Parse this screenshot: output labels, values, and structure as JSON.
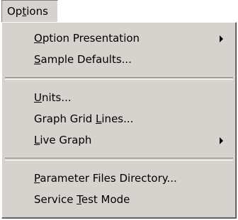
{
  "menubar": {
    "title": "Options",
    "title_parts": [
      "Op",
      "t",
      "ions"
    ]
  },
  "menu": {
    "groups": [
      [
        {
          "label": "Option Presentation",
          "parts": [
            "",
            "O",
            "ption Presentation"
          ],
          "submenu": true
        },
        {
          "label": "Sample Defaults...",
          "parts": [
            "",
            "S",
            "ample Defaults..."
          ],
          "submenu": false
        }
      ],
      [
        {
          "label": "Units...",
          "parts": [
            "",
            "U",
            "nits..."
          ],
          "submenu": false
        },
        {
          "label": "Graph Grid Lines...",
          "parts": [
            "Graph Grid ",
            "L",
            "ines..."
          ],
          "submenu": false
        },
        {
          "label": "Live Graph",
          "parts": [
            "",
            "L",
            "ive Graph"
          ],
          "submenu": true
        }
      ],
      [
        {
          "label": "Parameter Files Directory...",
          "parts": [
            "",
            "P",
            "arameter Files Directory..."
          ],
          "submenu": false
        },
        {
          "label": "Service Test Mode",
          "parts": [
            "Service ",
            "T",
            "est Mode"
          ],
          "submenu": false
        }
      ]
    ]
  }
}
